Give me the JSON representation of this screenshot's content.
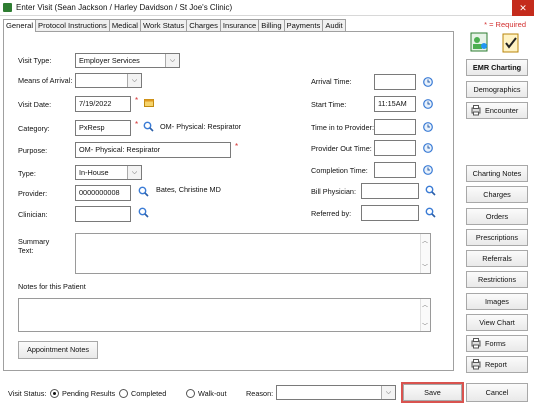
{
  "window": {
    "title": "Enter Visit (Sean Jackson / Harley Davidson / St Joe's Clinic)",
    "close": "✕"
  },
  "tabs": [
    "General",
    "Protocol Instructions",
    "Medical",
    "Work Status",
    "Charges",
    "Insurance",
    "Billing",
    "Payments",
    "Audit"
  ],
  "required_note": "* = Required",
  "form": {
    "visit_type": {
      "label": "Visit Type:",
      "value": "Employer Services"
    },
    "means": {
      "label": "Means of Arrival:",
      "value": ""
    },
    "visit_date": {
      "label": "Visit Date:",
      "value": "7/19/2022"
    },
    "category": {
      "label": "Category:",
      "value": "PxResp",
      "description": "OM- Physical: Respirator"
    },
    "purpose": {
      "label": "Purpose:",
      "value": "OM- Physical: Respirator"
    },
    "type": {
      "label": "Type:",
      "value": "In-House"
    },
    "provider": {
      "label": "Provider:",
      "value": "0000000008",
      "name": "Bates, Christine  MD"
    },
    "clinician": {
      "label": "Clinician:",
      "value": ""
    },
    "arrival_time": {
      "label": "Arrival Time:",
      "value": ""
    },
    "start_time": {
      "label": "Start Time:",
      "value": "11:15AM"
    },
    "time_in_provider": {
      "label": "Time in to Provider:",
      "value": ""
    },
    "provider_out": {
      "label": "Provider Out Time:",
      "value": ""
    },
    "completion": {
      "label": "Completion Time:",
      "value": ""
    },
    "bill_physician": {
      "label": "Bill Physician:",
      "value": ""
    },
    "referred_by": {
      "label": "Referred by:",
      "value": ""
    },
    "summary": {
      "label1": "Summary",
      "label2": "Text:"
    },
    "notes_label": "Notes for this Patient",
    "appt_notes_button": "Appointment Notes"
  },
  "sidebar": {
    "emr": "EMR Charting",
    "demographics": "Demographics",
    "encounter": "Encounter",
    "buttons": [
      "Charting Notes",
      "Charges",
      "Orders",
      "Prescriptions",
      "Referrals",
      "Restrictions",
      "Images",
      "View Chart"
    ],
    "forms": "Forms",
    "report": "Report"
  },
  "bottom": {
    "visit_status_label": "Visit Status:",
    "statuses": [
      "Pending Results",
      "Completed",
      "Walk-out"
    ],
    "reason_label": "Reason:",
    "reason_value": "",
    "save": "Save",
    "cancel": "Cancel"
  },
  "colors": {
    "required": "#d32f2f",
    "save_highlight": "#d9534f",
    "clock_icon": "#3a7bd5",
    "search_icon": "#3a7bd5"
  }
}
